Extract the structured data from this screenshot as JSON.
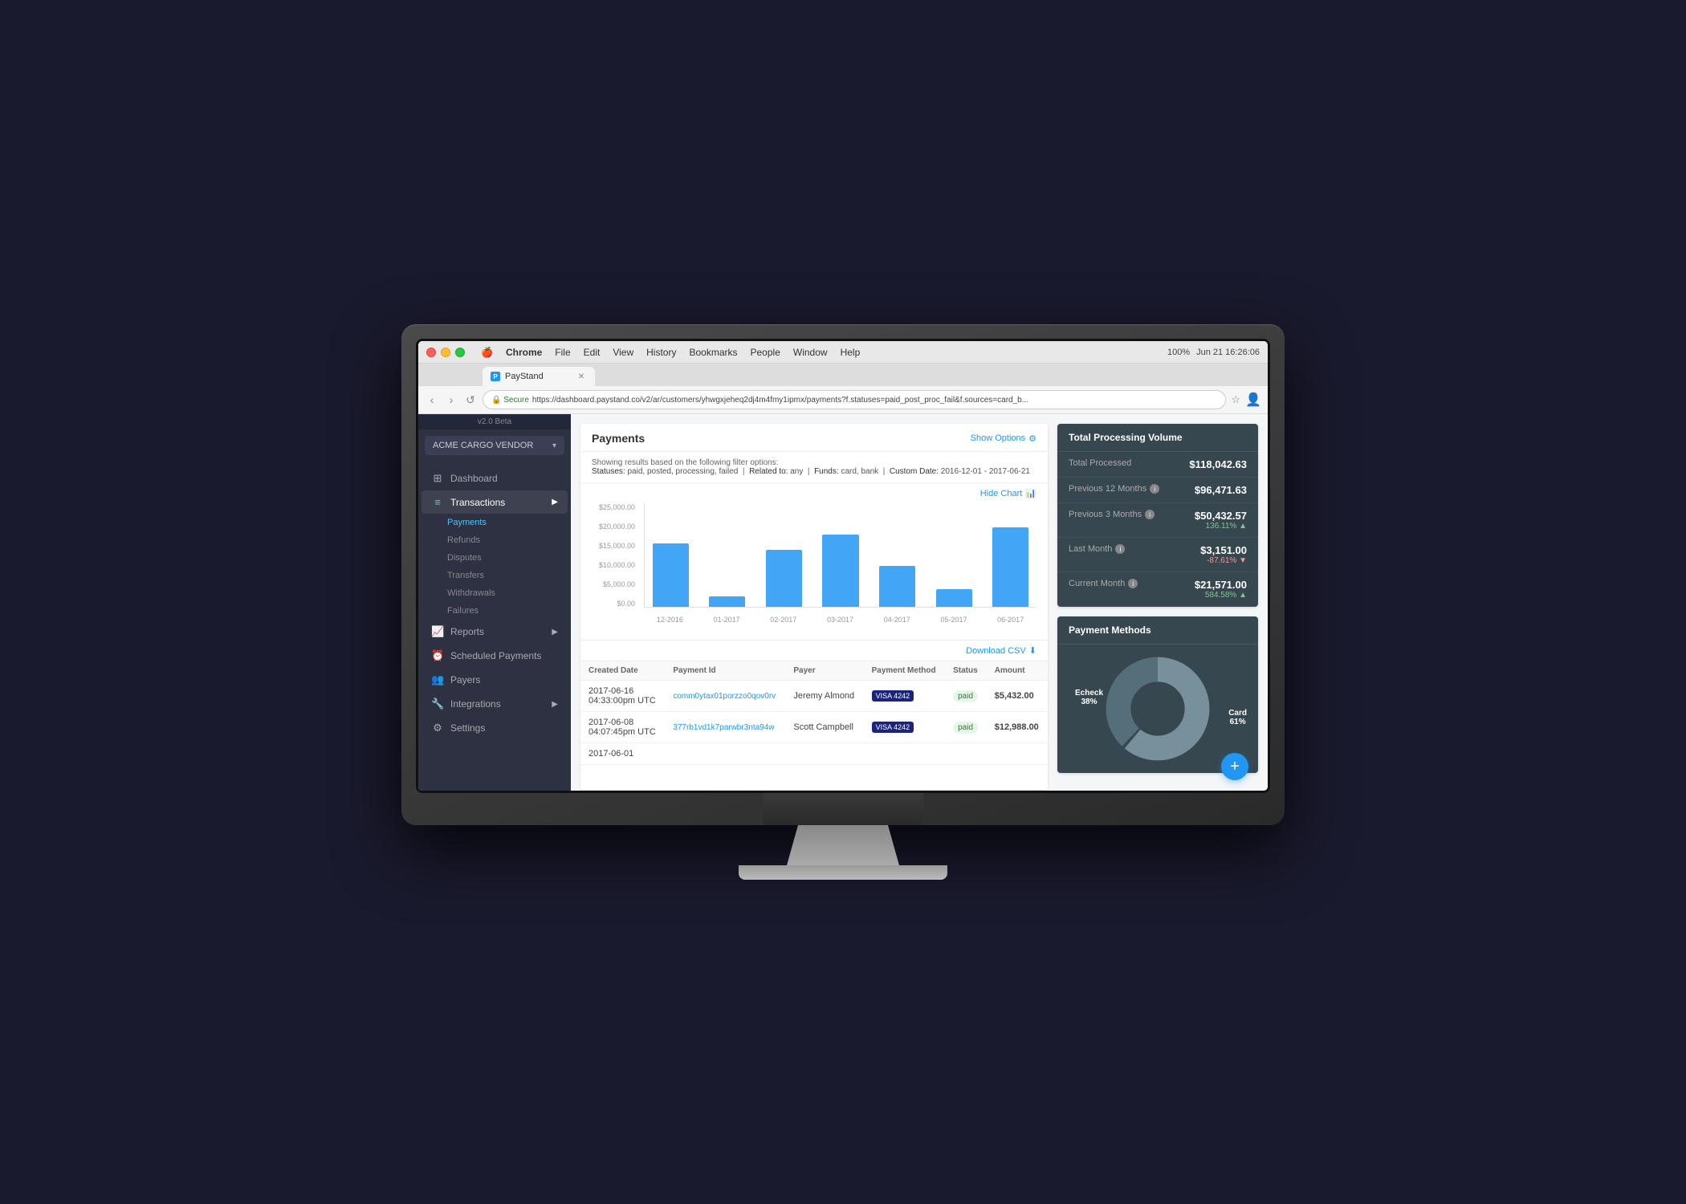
{
  "os": {
    "menu_items": [
      "Apple",
      "Chrome",
      "File",
      "Edit",
      "View",
      "History",
      "Bookmarks",
      "People",
      "Window",
      "Help"
    ],
    "time": "Jun 21  16:26:06",
    "battery": "100%"
  },
  "browser": {
    "tab_title": "PayStand",
    "url_secure": "Secure",
    "url_full": "https://dashboard.paystand.co/v2/ar/customers/yhwgxjeheq2dj4m4fmy1ipmx/payments?f.statuses=paid_post_proc_fail&f.sources=card_b...",
    "back": "‹",
    "forward": "›",
    "reload": "↺"
  },
  "sidebar": {
    "version": "v2.0 Beta",
    "vendor_name": "ACME CARGO VENDOR",
    "nav_items": [
      {
        "label": "Dashboard",
        "icon": "⊞",
        "active": false,
        "has_arrow": false
      },
      {
        "label": "Transactions",
        "icon": "≡",
        "active": true,
        "has_arrow": true
      },
      {
        "label": "Reports",
        "icon": "📈",
        "active": false,
        "has_arrow": true
      },
      {
        "label": "Scheduled Payments",
        "icon": "⏰",
        "active": false,
        "has_arrow": false
      },
      {
        "label": "Payers",
        "icon": "👥",
        "active": false,
        "has_arrow": false
      },
      {
        "label": "Integrations",
        "icon": "🔧",
        "active": false,
        "has_arrow": true
      },
      {
        "label": "Settings",
        "icon": "⚙",
        "active": false,
        "has_arrow": false
      }
    ],
    "sub_items": [
      "Payments",
      "Refunds",
      "Disputes",
      "Transfers",
      "Withdrawals",
      "Failures"
    ]
  },
  "payments_panel": {
    "title": "Payments",
    "show_options_label": "Show Options",
    "filter_text": "Showing results based on the following filter options:",
    "filter_statuses": "paid, posted, processing, failed",
    "filter_related": "any",
    "filter_funds": "card, bank",
    "filter_date": "2016-12-01 - 2017-06-21",
    "hide_chart_label": "Hide Chart",
    "download_label": "Download CSV",
    "chart": {
      "y_labels": [
        "$25,000.00",
        "$20,000.00",
        "$15,000.00",
        "$10,000.00",
        "$5,000.00",
        "$0.00"
      ],
      "bars": [
        {
          "label": "12-2016",
          "height_pct": 72
        },
        {
          "label": "01-2017",
          "height_pct": 12
        },
        {
          "label": "02-2017",
          "height_pct": 65
        },
        {
          "label": "03-2017",
          "height_pct": 82
        },
        {
          "label": "04-2017",
          "height_pct": 46
        },
        {
          "label": "05-2017",
          "height_pct": 20
        },
        {
          "label": "06-2017",
          "height_pct": 90
        }
      ]
    },
    "table_headers": [
      "Created Date",
      "Payment Id",
      "Payer",
      "Payment Method",
      "Status",
      "Amount"
    ],
    "table_rows": [
      {
        "date": "2017-06-16",
        "time": "04:33:00pm UTC",
        "payment_id": "comm0ytax01porzzo0qov0rv",
        "payer": "Jeremy Almond",
        "method": "VISA 4242",
        "status": "paid",
        "amount": "$5,432.00"
      },
      {
        "date": "2017-06-08",
        "time": "04:07:45pm UTC",
        "payment_id": "377rb1vd1k7parwbr3nta94w",
        "payer": "Scott Campbell",
        "method": "VISA 4242",
        "status": "paid",
        "amount": "$12,988.00"
      },
      {
        "date": "2017-06-01",
        "time": "",
        "payment_id": "...",
        "payer": "",
        "method": "",
        "status": "",
        "amount": ""
      }
    ]
  },
  "volume": {
    "title": "Total Processing Volume",
    "rows": [
      {
        "label": "Total Processed",
        "has_info": false,
        "amount": "$118,042.63",
        "change": null
      },
      {
        "label": "Previous 12 Months",
        "has_info": true,
        "amount": "$96,471.63",
        "change": null
      },
      {
        "label": "Previous 3 Months",
        "has_info": true,
        "amount": "$50,432.57",
        "change": "136.11% ▲",
        "change_type": "up"
      },
      {
        "label": "Last Month",
        "has_info": true,
        "amount": "$3,151.00",
        "change": "-87.61% ▼",
        "change_type": "down"
      },
      {
        "label": "Current Month",
        "has_info": true,
        "amount": "$21,571.00",
        "change": "584.58% ▲",
        "change_type": "up"
      }
    ]
  },
  "payment_methods": {
    "title": "Payment Methods",
    "segments": [
      {
        "label": "Echeck",
        "pct": 38,
        "color": "#546e7a"
      },
      {
        "label": "Card",
        "pct": 61,
        "color": "#78909c"
      }
    ]
  },
  "fab": {
    "label": "+"
  }
}
